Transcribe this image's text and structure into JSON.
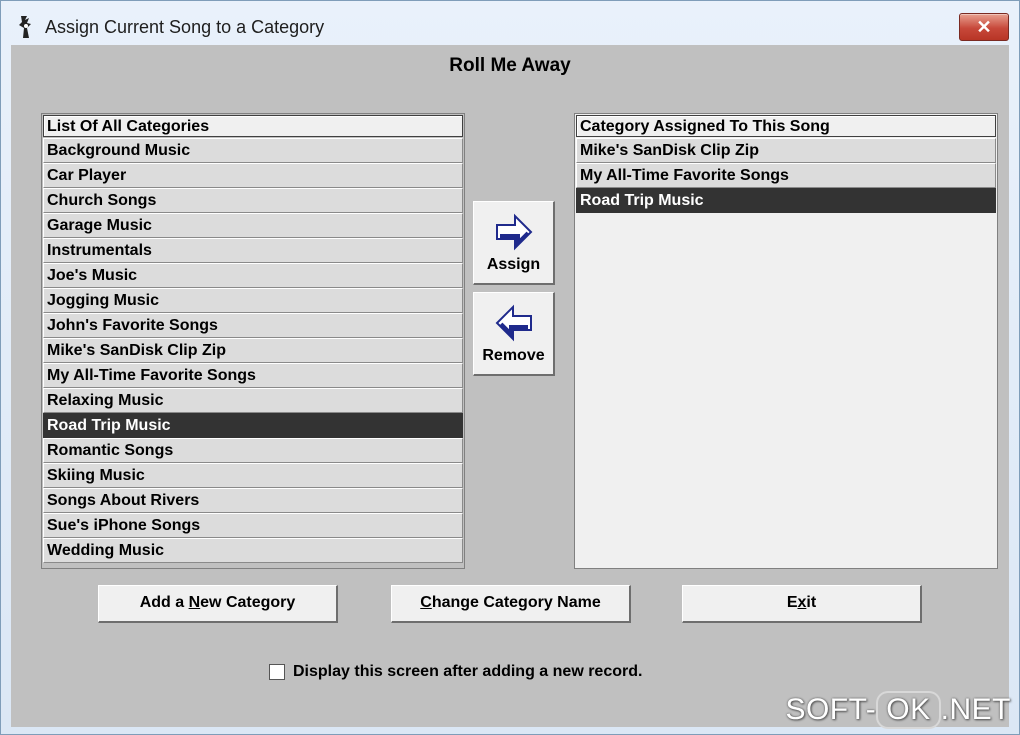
{
  "window": {
    "title": "Assign Current Song to a Category",
    "close_glyph": "✕"
  },
  "song": {
    "title": "Roll Me Away"
  },
  "all_categories": {
    "header": "List Of All Categories",
    "items": [
      "Background Music",
      "Car Player",
      "Church Songs",
      "Garage Music",
      "Instrumentals",
      "Joe's Music",
      "Jogging Music",
      "John's Favorite Songs",
      "Mike's SanDisk Clip Zip",
      "My All-Time Favorite Songs",
      "Relaxing Music",
      "Road Trip Music",
      "Romantic Songs",
      "Skiing Music",
      "Songs About Rivers",
      "Sue's iPhone Songs",
      "Wedding Music"
    ],
    "selected": "Road Trip Music"
  },
  "assigned_categories": {
    "header": "Category Assigned To This Song",
    "items": [
      "Mike's SanDisk Clip Zip",
      "My All-Time Favorite Songs",
      "Road Trip Music"
    ],
    "selected": "Road Trip Music"
  },
  "buttons": {
    "assign": "Assign",
    "remove": "Remove",
    "add_new_category_pre": "Add a ",
    "add_new_category_u": "N",
    "add_new_category_post": "ew Category",
    "change_name_u": "C",
    "change_name_post": "hange Category Name",
    "exit_pre": "E",
    "exit_u": "x",
    "exit_post": "it"
  },
  "checkbox": {
    "label": "Display this screen after adding a new record.",
    "checked": false
  },
  "watermark": {
    "left": "SOFT-",
    "ok": "OK",
    "right": ".NET"
  },
  "colors": {
    "selected_row": "#333333",
    "client_bg": "#c0c0c0",
    "arrow_fill": "#1f2a8c"
  },
  "icons": {
    "assign": "right-arrow-icon",
    "remove": "left-arrow-icon",
    "app": "app-icon"
  }
}
